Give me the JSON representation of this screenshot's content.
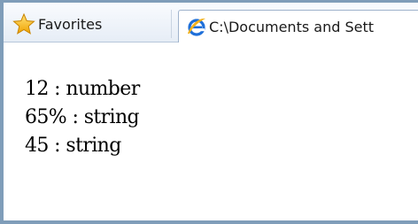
{
  "toolbar": {
    "favorites_label": "Favorites",
    "favorites_icon": "star-icon",
    "tab_title": "C:\\Documents and Sett",
    "tab_icon": "ie-icon"
  },
  "content": {
    "lines": [
      "12 : number",
      "65% : string",
      "45 : string"
    ]
  },
  "colors": {
    "frame": "#7f9db9",
    "toolbar": "#e6edf6",
    "ie_blue": "#1e6fd9",
    "star": "#f5b70f"
  }
}
